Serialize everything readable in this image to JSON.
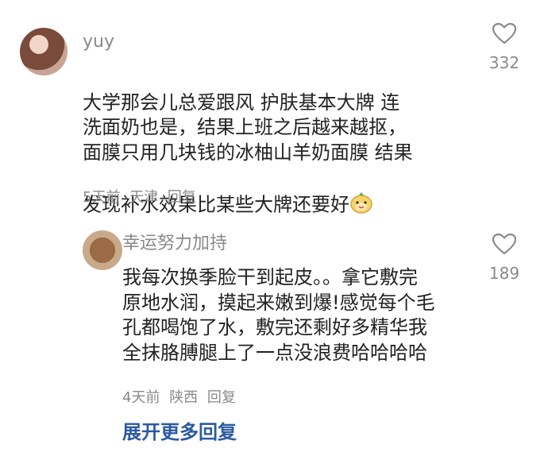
{
  "comment1": {
    "username": "yuy",
    "text": "大学那会儿总爱跟风 护肤基本大牌 连\n洗面奶也是，结果上班之后越来越抠，\n面膜只用几块钱的冰柚山羊奶面膜 结果\n发现补水效果比某些大牌还要好",
    "emoji": "cute-face-emoji",
    "time": "5天前",
    "location": "天津",
    "reply_label": "回复",
    "likes": "332"
  },
  "reply1": {
    "username": "幸运努力加持",
    "text": "我每次换季脸干到起皮。。拿它敷完\n原地水润，摸起来嫩到爆!感觉每个毛\n孔都喝饱了水，敷完还剩好多精华我\n全抹胳膊腿上了一点没浪费哈哈哈哈",
    "time": "4天前",
    "location": "陕西",
    "reply_label": "回复",
    "likes": "189"
  },
  "expand_label": "展开更多回复",
  "icons": {
    "like": "heart-outline-icon"
  },
  "colors": {
    "meta": "#8a8a8a",
    "text": "#222222",
    "link": "#2c5aa0"
  }
}
